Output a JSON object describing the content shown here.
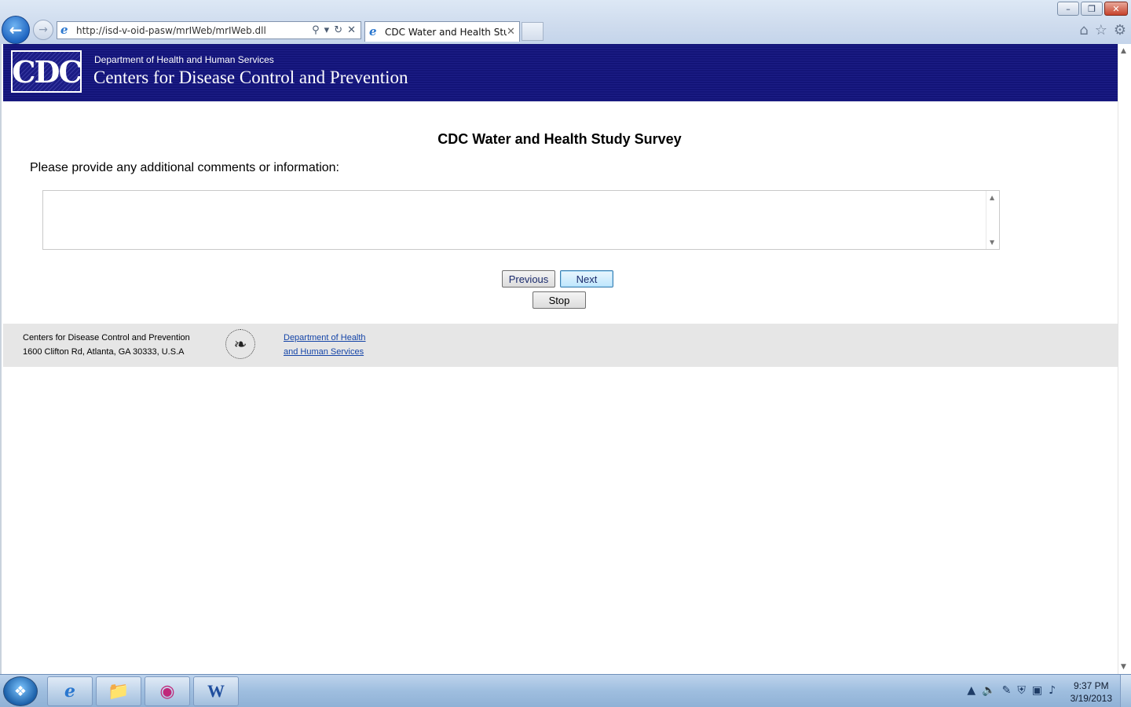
{
  "browser": {
    "url": "http://isd-v-oid-pasw/mrIWeb/mrIWeb.dll",
    "tab_title": "CDC Water and Health Study",
    "window_buttons": {
      "minimize": "–",
      "restore": "❐",
      "close": "✕"
    },
    "icons": [
      "back-arrow-icon",
      "forward-arrow-icon",
      "ie-icon",
      "search-icon",
      "refresh-icon",
      "stop-icon",
      "home-icon",
      "favorites-star-icon",
      "tools-gear-icon"
    ]
  },
  "cdc_header": {
    "logo_text": "CDC",
    "department": "Department of Health and Human Services",
    "center": "Centers for Disease Control and Prevention"
  },
  "survey": {
    "title": "CDC Water and Health Study Survey",
    "question": "Please provide any additional comments or information:",
    "comment_value": "",
    "buttons": {
      "previous": "Previous",
      "next": "Next",
      "stop": "Stop"
    }
  },
  "footer": {
    "org_name": "Centers for Disease Control and Prevention",
    "address": "1600 Clifton Rd, Atlanta, GA 30333, U.S.A",
    "hhs_link_line1": "Department of Health",
    "hhs_link_line2": "and Human Services"
  },
  "taskbar": {
    "apps": [
      "internet-explorer",
      "windows-explorer",
      "media-app",
      "microsoft-word"
    ],
    "time": "9:37 PM",
    "date": "3/19/2013"
  },
  "colors": {
    "header_navy": "#131478",
    "footer_gray": "#e6e6e6",
    "link_blue": "#1545a8"
  }
}
